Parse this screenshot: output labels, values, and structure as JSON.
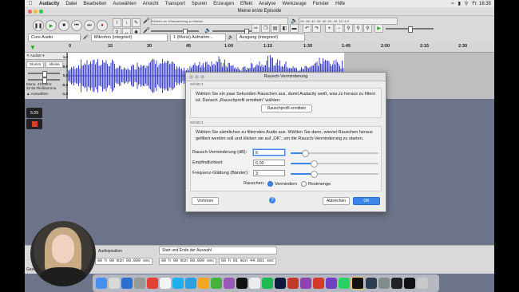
{
  "menubar": {
    "app": "Audacity",
    "items": [
      "Datei",
      "Bearbeiten",
      "Auswählen",
      "Ansicht",
      "Transport",
      "Spuren",
      "Erzeugen",
      "Effekt",
      "Analyse",
      "Werkzeuge",
      "Fenster",
      "Hilfe"
    ],
    "clock": "Fr. 16:35"
  },
  "window": {
    "title": "Meine erste Episode"
  },
  "toolbar": {
    "monitor_hint": "Klicken zur Überwachung zu starten",
    "meter_ticks": "-54 -48 -42 -36 -30 -24 -18 -12 -6 0",
    "host": "Core Audio",
    "mic": "Mikrofon (integriert)",
    "channels": "1 (Mono) Aufnahm...",
    "output": "Ausgang (integriert)"
  },
  "ruler": {
    "ticks": [
      "0",
      "15",
      "30",
      "45",
      "1:00",
      "1:15",
      "1:30",
      "1:45",
      "2:00",
      "2:15",
      "2:30"
    ]
  },
  "track": {
    "name": "Audiotr",
    "mute": "Stumm",
    "solo": "Alleine",
    "info": "Mono, 44100Hz\n32-bit Fließkomma",
    "select": "Auswählen",
    "scale": [
      "1,0",
      "0,5",
      "0,0",
      "-0,5",
      "-1,0"
    ]
  },
  "sidebar": {
    "timer": "5:29"
  },
  "bottom": {
    "audio_pos_label": "Audioposition",
    "selection_label": "Start und Ende der Auswahl",
    "pos_value": "00 h 00 min 00.000 sec",
    "start_value": "00 h 00 min 00.000 sec",
    "end_value": "00 h 01 min 44.081 sec",
    "status_left": "Gesto"
  },
  "dialog": {
    "title": "Rausch-Verminderung",
    "step1_label": "Schritt 1",
    "step1_text": "Wählen Sie ein paar Sekunden Rauschen aus, damit Audacity weiß, was zu heraus zu filtern ist. Danach „Rauschprofil ermitteln“ wählen:",
    "profile_button": "Rauschprofil ermitteln",
    "step2_label": "Schritt 2",
    "step2_text": "Wählen Sie sämtliches zu filterndes Audio aus. Wählen Sie dann, wieviel Rauschen heraus gefiltert werden soll und klicken sie auf „OK“, um die Rausch-Verminderung zu starten.",
    "reduction_label": "Rausch-Verminderung (dB):",
    "reduction_value": "6",
    "reduction_level": 0.15,
    "sensitivity_label": "Empfindlichkeit:",
    "sensitivity_value": "6,00",
    "sensitivity_level": 0.25,
    "smoothing_label": "Frequenz-Glättung (Bänder):",
    "smoothing_value": "3",
    "smoothing_level": 0.25,
    "noise_label": "Rauschen:",
    "option_reduce": "Vermindern",
    "option_residue": "Restmenge",
    "preview_button": "Vorhören",
    "help": "?",
    "cancel_button": "Abbrechen",
    "ok_button": "OK"
  },
  "colors": {
    "accent": "#3b86e8",
    "waveform": "#3f44c8",
    "desktop": "#6d7389"
  }
}
